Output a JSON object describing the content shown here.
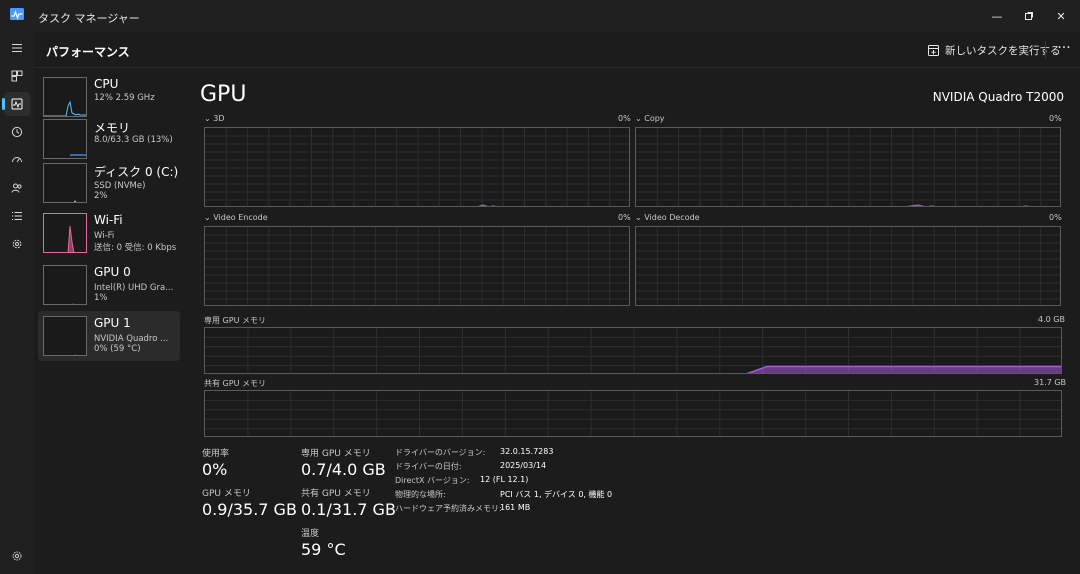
{
  "window": {
    "title": "タスク マネージャー",
    "minimize_glyph": "—",
    "maximize_glyph": "▫",
    "close_glyph": "✕"
  },
  "header": {
    "title": "パフォーマンス",
    "new_task_label": "新しいタスクを実行する",
    "more_glyph": "···"
  },
  "nav": [
    {
      "icon": "hamburger-icon"
    },
    {
      "icon": "processes-icon"
    },
    {
      "icon": "performance-icon",
      "active": true
    },
    {
      "icon": "app-history-icon"
    },
    {
      "icon": "startup-apps-icon"
    },
    {
      "icon": "users-icon"
    },
    {
      "icon": "details-icon"
    },
    {
      "icon": "services-icon"
    },
    {
      "icon": "settings-icon"
    }
  ],
  "devices": [
    {
      "name": "CPU",
      "line1": "12%  2.59 GHz",
      "line2": "",
      "color": "#4cc2ff"
    },
    {
      "name": "メモリ",
      "line1": "8.0/63.3 GB (13%)",
      "line2": "",
      "color": "#4c9aff"
    },
    {
      "name": "ディスク 0 (C:)",
      "line1": "SSD (NVMe)",
      "line2": "2%",
      "color": "#9be35a"
    },
    {
      "name": "Wi-Fi",
      "line1": "Wi-Fi",
      "line2": "送信: 0  受信: 0 Kbps",
      "color": "#e36a9d"
    },
    {
      "name": "GPU 0",
      "line1": "Intel(R) UHD Gra...",
      "line2": "1%",
      "color": "#a65bd9"
    },
    {
      "name": "GPU 1",
      "line1": "NVIDIA Quadro ...",
      "line2": "0% (59 °C)",
      "color": "#a65bd9",
      "active": true
    }
  ],
  "main": {
    "title": "GPU",
    "model": "NVIDIA Quadro T2000",
    "engines": [
      {
        "label": "3D",
        "value": "0%"
      },
      {
        "label": "Copy",
        "value": "0%"
      },
      {
        "label": "Video Encode",
        "value": "0%"
      },
      {
        "label": "Video Decode",
        "value": "0%"
      }
    ],
    "dedicated_label": "専用 GPU メモリ",
    "dedicated_max": "4.0 GB",
    "shared_label": "共有 GPU メモリ",
    "shared_max": "31.7 GB",
    "dedicated_fraction": 0.18,
    "shared_fraction": 0.0
  },
  "stats": {
    "util_label": "使用率",
    "util_value": "0%",
    "ded_label": "専用 GPU メモリ",
    "ded_value": "0.7/4.0 GB",
    "gpumem_label": "GPU メモリ",
    "gpumem_value": "0.9/35.7 GB",
    "shared_label": "共有 GPU メモリ",
    "shared_value": "0.1/31.7 GB",
    "temp_label": "温度",
    "temp_value": "59 °C"
  },
  "info": [
    {
      "label": "ドライバーのバージョン:",
      "value": "32.0.15.7283"
    },
    {
      "label": "ドライバーの日付:",
      "value": "2025/03/14"
    },
    {
      "label": "DirectX バージョン:",
      "value": "12 (FL 12.1)"
    },
    {
      "label": "物理的な場所:",
      "value": "PCI バス 1, デバイス 0, 機能 0"
    },
    {
      "label": "ハードウェア予約済みメモリ:",
      "value": "161 MB"
    }
  ],
  "colors": {
    "accent": "#4cc2ff",
    "gpu": "#a65bd9",
    "background": "#1c1c1c",
    "grid": "#2f2f2f"
  }
}
